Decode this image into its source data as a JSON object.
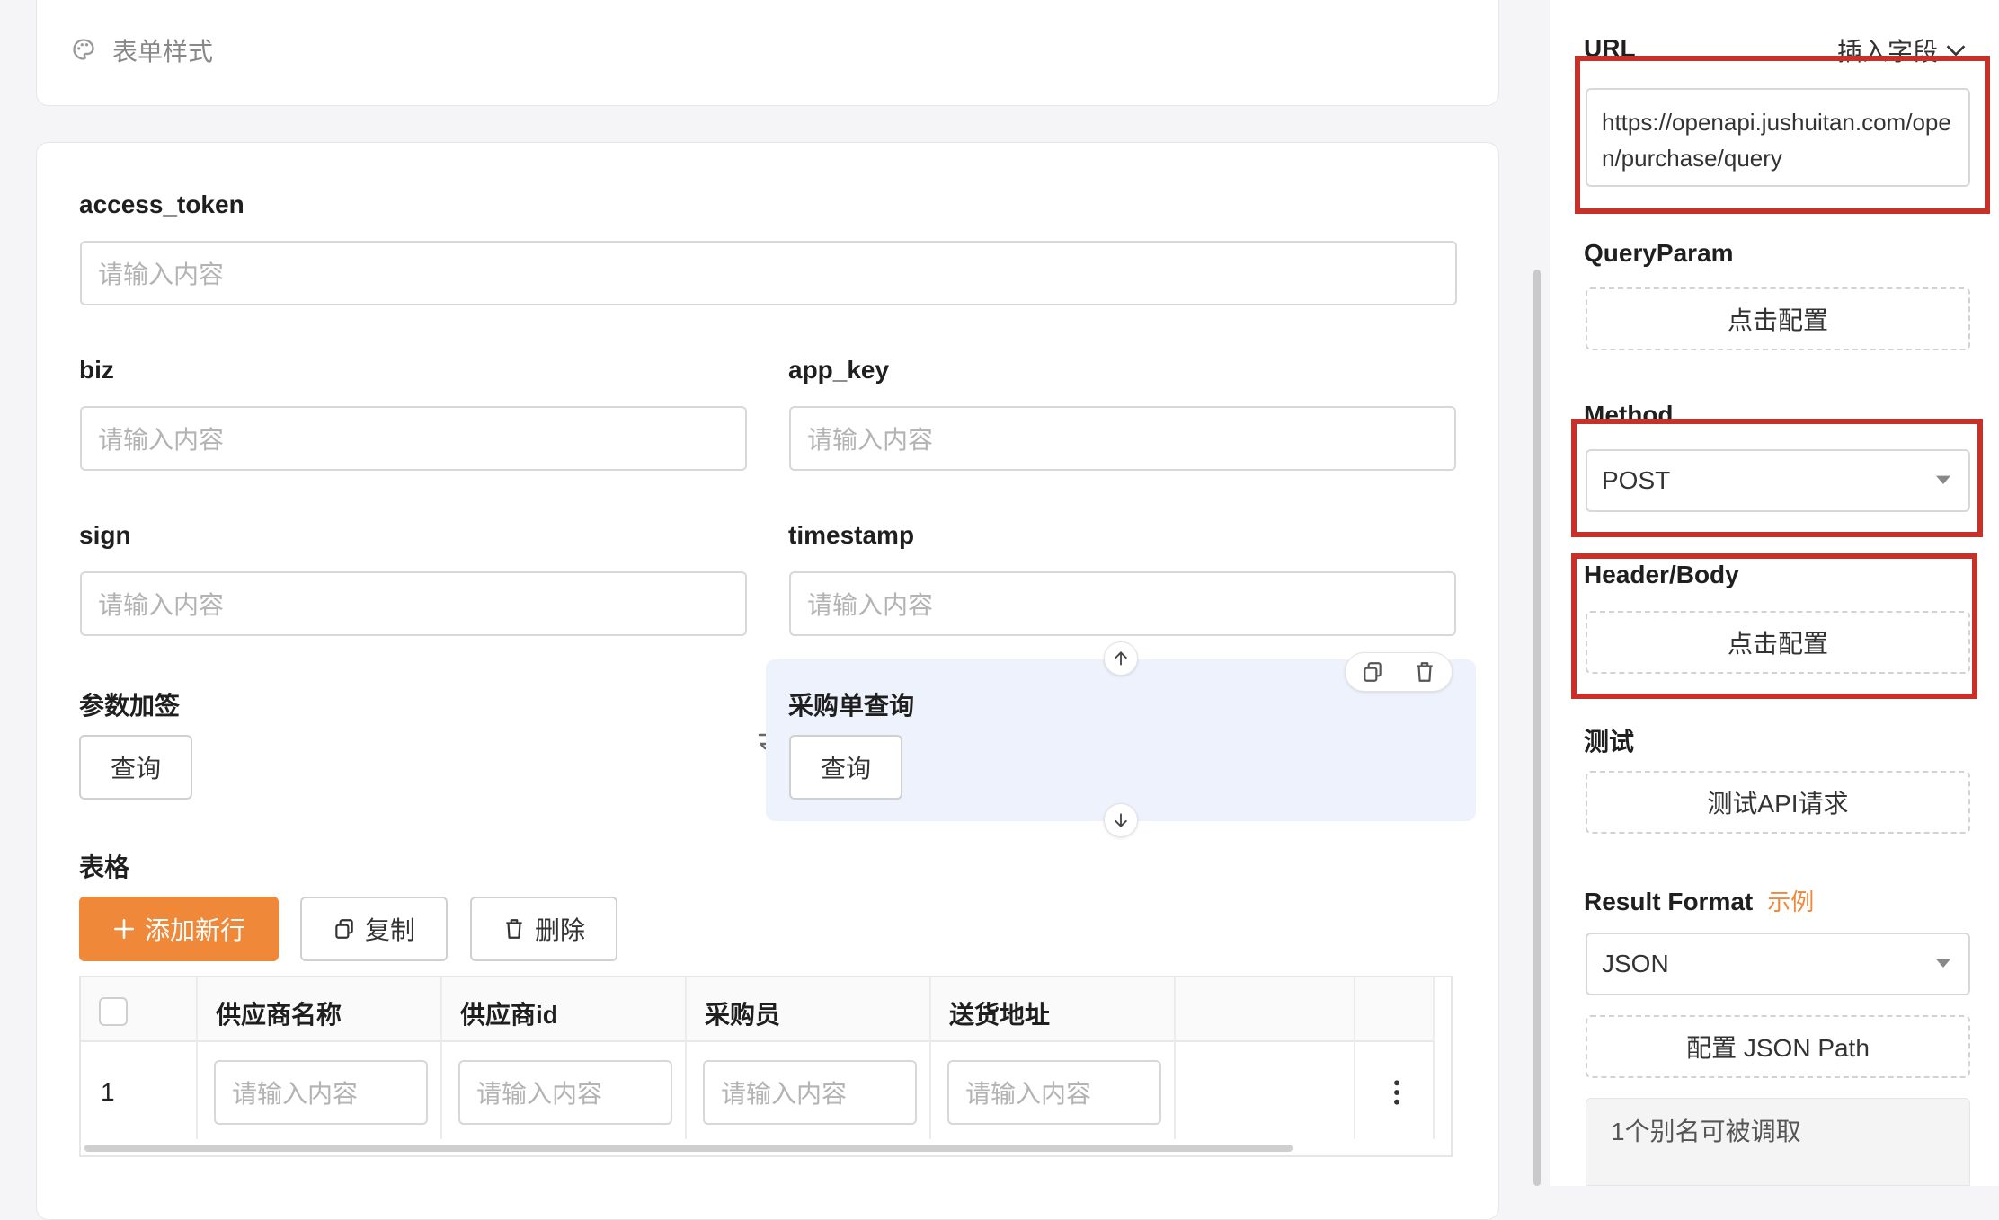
{
  "top_card": {
    "form_style_label": "表单样式"
  },
  "form": {
    "access_token": {
      "label": "access_token",
      "placeholder": "请输入内容"
    },
    "biz": {
      "label": "biz",
      "placeholder": "请输入内容"
    },
    "app_key": {
      "label": "app_key",
      "placeholder": "请输入内容"
    },
    "sign": {
      "label": "sign",
      "placeholder": "请输入内容"
    },
    "timestamp": {
      "label": "timestamp",
      "placeholder": "请输入内容"
    },
    "param_sign": {
      "label": "参数加签",
      "button": "查询"
    },
    "purchase_query": {
      "label": "采购单查询",
      "button": "查询"
    }
  },
  "table_section": {
    "label": "表格",
    "add_row": "添加新行",
    "copy": "复制",
    "delete": "删除",
    "headers": [
      "供应商名称",
      "供应商id",
      "采购员",
      "送货地址"
    ],
    "rows": [
      {
        "index": "1",
        "cells": [
          "请输入内容",
          "请输入内容",
          "请输入内容",
          "请输入内容"
        ]
      }
    ]
  },
  "panel": {
    "url_label": "URL",
    "insert_field": "插入字段",
    "url_value": "https://openapi.jushuitan.com/open/purchase/query",
    "query_param_label": "QueryParam",
    "query_param_btn": "点击配置",
    "method_label": "Method",
    "method_value": "POST",
    "header_body_label": "Header/Body",
    "header_body_btn": "点击配置",
    "test_label": "测试",
    "test_btn": "测试API请求",
    "result_format_label": "Result Format",
    "result_format_example": "示例",
    "result_format_value": "JSON",
    "json_path_btn": "配置 JSON Path",
    "alias_text": "1个别名可被调取"
  },
  "colors": {
    "accent": "#f0883a",
    "highlight_red": "#c8302a",
    "selected_bg": "#eef2fc"
  }
}
